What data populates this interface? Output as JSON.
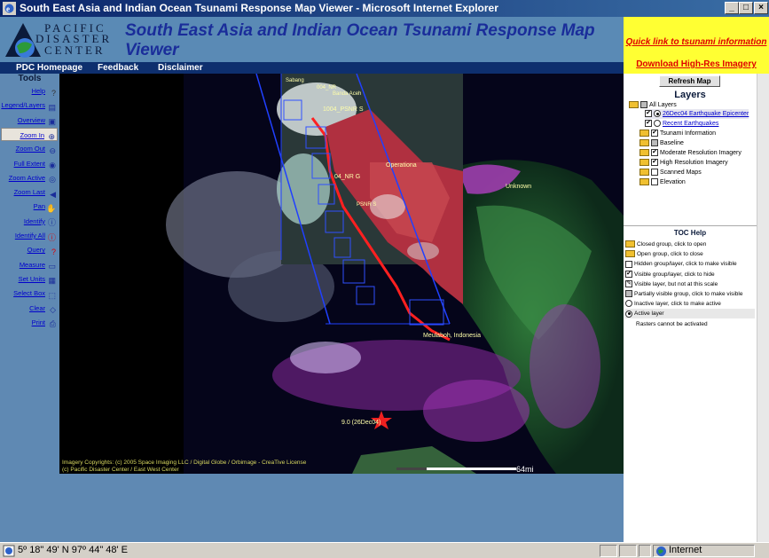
{
  "window": {
    "title": "South East Asia and Indian Ocean Tsunami Response Map Viewer - Microsoft Internet Explorer",
    "minimize": "_",
    "maximize": "□",
    "close": "×"
  },
  "header": {
    "logo_line1": "PACIFIC",
    "logo_line2": "DISASTER",
    "logo_line3": "CENTER",
    "title": "South East Asia and Indian Ocean Tsunami Response Map Viewer"
  },
  "right_links": {
    "quick_link": "Quick link to tsunami information",
    "hires_link": "Download High-Res Imagery"
  },
  "nav": {
    "homepage": "PDC Homepage",
    "feedback": "Feedback",
    "disclaimer": "Disclaimer"
  },
  "tools": {
    "header": "Tools",
    "items": [
      {
        "label": "Help",
        "icon": "help-icon"
      },
      {
        "label": "Legend/Layers",
        "icon": "legend-icon"
      },
      {
        "label": "Overview",
        "icon": "overview-icon"
      },
      {
        "label": "Zoom In",
        "icon": "zoom-in-icon"
      },
      {
        "label": "Zoom Out",
        "icon": "zoom-out-icon"
      },
      {
        "label": "Full Extent",
        "icon": "globe-icon"
      },
      {
        "label": "Zoom Active",
        "icon": "zoom-active-icon"
      },
      {
        "label": "Zoom Last",
        "icon": "back-arrow-icon"
      },
      {
        "label": "Pan",
        "icon": "hand-icon"
      },
      {
        "label": "Identify",
        "icon": "info-icon"
      },
      {
        "label": "Identify All",
        "icon": "info-all-icon"
      },
      {
        "label": "Query",
        "icon": "query-icon"
      },
      {
        "label": "Measure",
        "icon": "ruler-icon"
      },
      {
        "label": "Set Units",
        "icon": "units-icon"
      },
      {
        "label": "Select Box",
        "icon": "select-box-icon"
      },
      {
        "label": "Clear",
        "icon": "eraser-icon"
      },
      {
        "label": "Print",
        "icon": "printer-icon"
      }
    ]
  },
  "map": {
    "labels": {
      "psnr": "1004_PSNR S",
      "nrg": "04_NR G",
      "operational": "Operationa",
      "unknown": "Unknown",
      "sabang": "Sabang",
      "banda": "Banda Aceh",
      "meulaboh": "Meulaboh, Indonesia",
      "epicenter": "9.0 (26Dec04)",
      "sample1": "004_NR",
      "sample2": "PSNR S"
    },
    "copyright1": "Imagery Copyrights: (c) 2005 Space Imaging LLC / Digital Globe / Orbimage - CreaTive License",
    "copyright2": "(c) Pacific Disaster Center / East West Center",
    "scale": "64mi"
  },
  "layers_panel": {
    "refresh": "Refresh Map",
    "title": "Layers",
    "items": [
      {
        "label": "All Layers"
      },
      {
        "label": "26Dec04 Earthquake Epicenter"
      },
      {
        "label": "Recent Earthquakes"
      },
      {
        "label": "Tsunami Information"
      },
      {
        "label": "Baseline"
      },
      {
        "label": "Moderate Resolution Imagery"
      },
      {
        "label": "High Resolution Imagery"
      },
      {
        "label": "Scanned Maps"
      },
      {
        "label": "Elevation"
      }
    ],
    "toc_title": "TOC Help",
    "toc": [
      "Closed group, click to open",
      "Open group, click to close",
      "Hidden group/layer, click to make visible",
      "Visible group/layer, click to hide",
      "Visible layer, but not at this scale",
      "Partially visible group, click to make visible",
      "Inactive layer, click to make active",
      "Active layer",
      "Rasters cannot be activated"
    ]
  },
  "status": {
    "coords": "5º 18\" 49' N 97º 44\" 48' E",
    "zone": "Internet"
  },
  "colors": {
    "nav": "#0e2f6e",
    "title": "#1a2d9a",
    "yellow": "#ffff33",
    "link_red": "#e00000"
  }
}
